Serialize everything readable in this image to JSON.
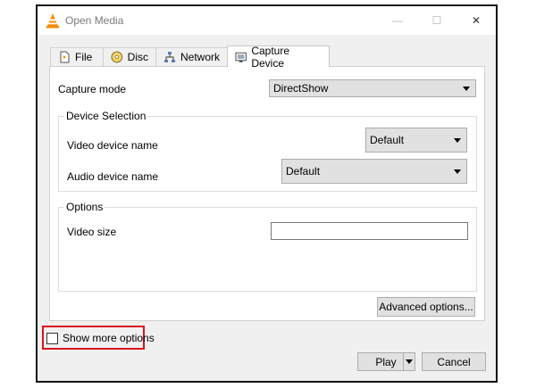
{
  "window": {
    "title": "Open Media",
    "minimize_glyph": "—",
    "maximize_glyph": "☐",
    "close_glyph": "✕"
  },
  "tabs": [
    {
      "label": "File",
      "icon": "file-icon"
    },
    {
      "label": "Disc",
      "icon": "disc-icon"
    },
    {
      "label": "Network",
      "icon": "network-icon"
    },
    {
      "label": "Capture Device",
      "icon": "capture-device-icon",
      "active": true
    }
  ],
  "capture": {
    "mode_label": "Capture mode",
    "mode_value": "DirectShow"
  },
  "device_selection": {
    "title": "Device Selection",
    "video_label": "Video device name",
    "video_value": "Default",
    "audio_label": "Audio device name",
    "audio_value": "Default"
  },
  "options": {
    "title": "Options",
    "video_size_label": "Video size",
    "video_size_value": "",
    "advanced_label": "Advanced options..."
  },
  "footer": {
    "show_more_label": "Show more options",
    "show_more_checked": false,
    "play_label": "Play",
    "cancel_label": "Cancel"
  },
  "colors": {
    "highlight": "#d9141c",
    "vlc_orange": "#f28c00"
  }
}
